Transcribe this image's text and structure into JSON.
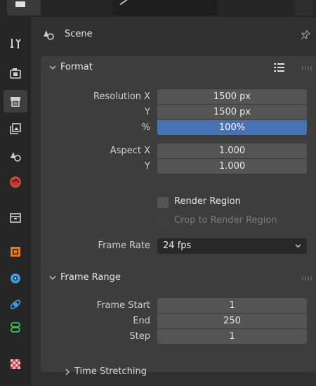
{
  "header": {
    "title": "Scene"
  },
  "panels": {
    "format": {
      "title": "Format",
      "resolution_x_label": "Resolution X",
      "resolution_x_value": "1500 px",
      "resolution_y_label": "Y",
      "resolution_y_value": "1500 px",
      "percent_label": "%",
      "percent_value": "100%",
      "aspect_x_label": "Aspect X",
      "aspect_x_value": "1.000",
      "aspect_y_label": "Y",
      "aspect_y_value": "1.000",
      "render_region_label": "Render Region",
      "crop_label": "Crop to Render Region",
      "frame_rate_label": "Frame Rate",
      "frame_rate_value": "24 fps"
    },
    "frame_range": {
      "title": "Frame Range",
      "start_label": "Frame Start",
      "start_value": "1",
      "end_label": "End",
      "end_value": "250",
      "step_label": "Step",
      "step_value": "1"
    },
    "time_stretching": {
      "title": "Time Stretching"
    }
  },
  "tabs": [
    {
      "name": "tool-tab",
      "icon": "wrench-screwdriver-icon"
    },
    {
      "name": "render-tab",
      "icon": "camera-back-icon"
    },
    {
      "name": "output-tab",
      "icon": "printer-icon",
      "active": true
    },
    {
      "name": "view-layer-tab",
      "icon": "image-stack-icon"
    },
    {
      "name": "scene-tab",
      "icon": "scene-cone-sphere-icon"
    },
    {
      "name": "world-tab",
      "icon": "world-globe-icon"
    },
    {
      "name": "collection-tab",
      "icon": "collection-box-icon"
    },
    {
      "name": "object-tab",
      "icon": "object-square-icon"
    },
    {
      "name": "modifier-tab",
      "icon": "circle-target-icon"
    },
    {
      "name": "physics-tab",
      "icon": "orbit-icon"
    },
    {
      "name": "constraints-tab",
      "icon": "constraint-link-icon"
    },
    {
      "name": "texture-tab",
      "icon": "checker-texture-icon"
    }
  ],
  "colors": {
    "accent": "#4772b3",
    "panel": "#3d3d3d",
    "field": "#545454",
    "background": "#303030"
  }
}
